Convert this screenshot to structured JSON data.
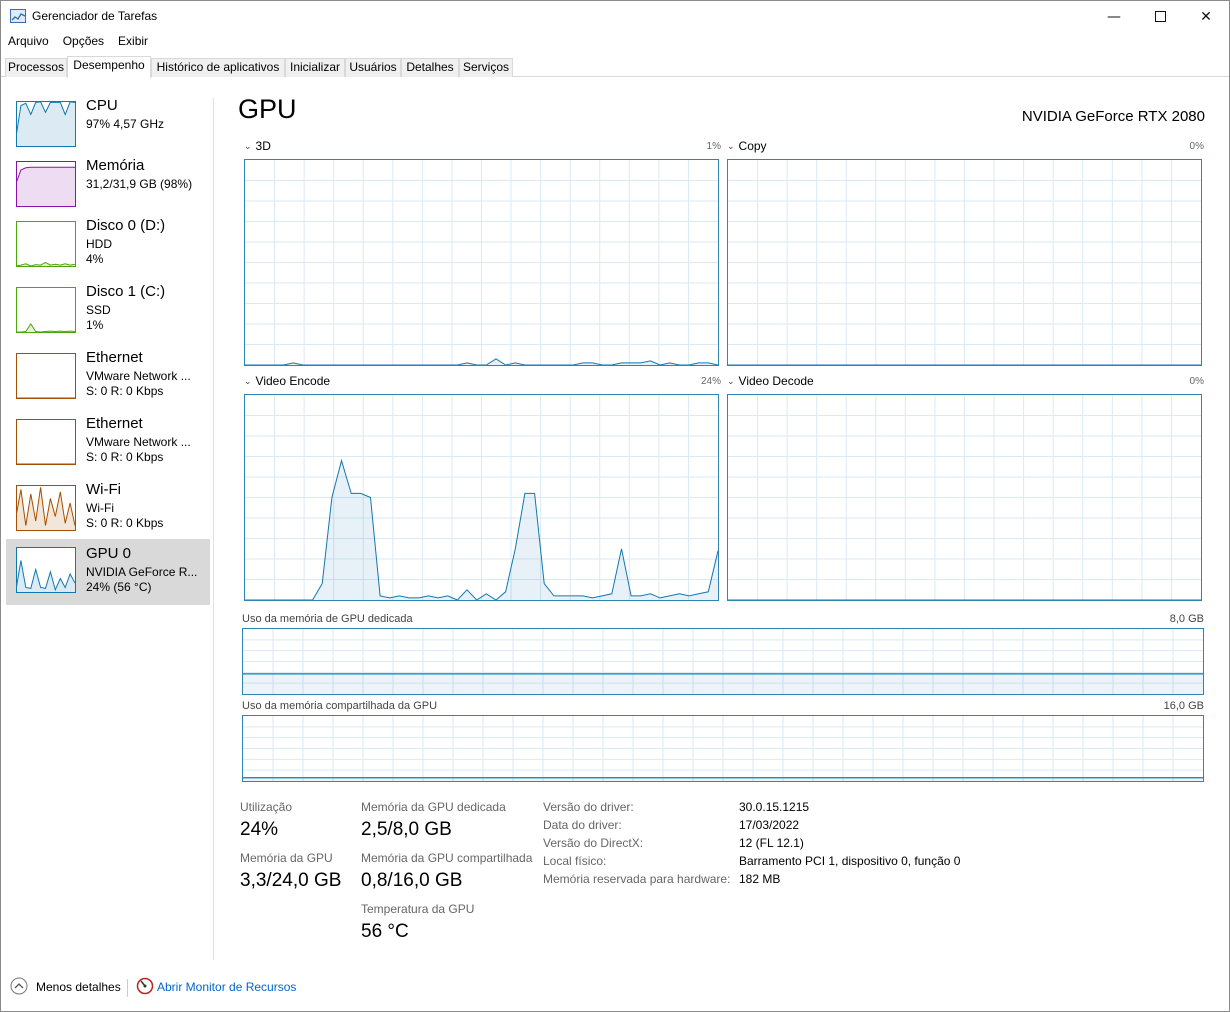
{
  "window": {
    "title": "Gerenciador de Tarefas"
  },
  "menu": [
    "Arquivo",
    "Opções",
    "Exibir"
  ],
  "tabs": [
    "Processos",
    "Desempenho",
    "Histórico de aplicativos",
    "Inicializar",
    "Usuários",
    "Detalhes",
    "Serviços"
  ],
  "active_tab": "Desempenho",
  "sidebar": {
    "items": [
      {
        "title": "CPU",
        "l1": "97% 4,57 GHz",
        "l2": "",
        "color": "#1178b0",
        "usage": 0.97
      },
      {
        "title": "Memória",
        "l1": "31,2/31,9 GB (98%)",
        "l2": "",
        "color": "#8b12ae",
        "usage": 0.98
      },
      {
        "title": "Disco 0 (D:)",
        "l1": "HDD",
        "l2": "4%",
        "color": "#4da60c",
        "usage": 0.04
      },
      {
        "title": "Disco 1 (C:)",
        "l1": "SSD",
        "l2": "1%",
        "color": "#4da60c",
        "usage": 0.01
      },
      {
        "title": "Ethernet",
        "l1": "VMware Network ...",
        "l2": "S: 0 R: 0 Kbps",
        "color": "#a74f01",
        "usage": 0
      },
      {
        "title": "Ethernet",
        "l1": "VMware Network ...",
        "l2": "S: 0 R: 0 Kbps",
        "color": "#a74f01",
        "usage": 0
      },
      {
        "title": "Wi-Fi",
        "l1": "Wi-Fi",
        "l2": "S: 0 R: 0 Kbps",
        "color": "#a74f01",
        "usage": 0
      },
      {
        "title": "GPU 0",
        "l1": "NVIDIA GeForce R...",
        "l2": "24% (56 °C)",
        "color": "#1178b0",
        "usage": 0.24
      }
    ]
  },
  "main": {
    "title": "GPU",
    "model": "NVIDIA GeForce RTX 2080",
    "engines": [
      {
        "name": "3D",
        "pct": "1%"
      },
      {
        "name": "Copy",
        "pct": "0%"
      },
      {
        "name": "Video Encode",
        "pct": "24%"
      },
      {
        "name": "Video Decode",
        "pct": "0%"
      }
    ],
    "dedicated_label": "Uso da memória de GPU dedicada",
    "dedicated_max": "8,0 GB",
    "dedicated_fraction": 0.31,
    "shared_label": "Uso da memória compartilhada da GPU",
    "shared_max": "16,0 GB",
    "shared_fraction": 0.05
  },
  "stats": {
    "util_label": "Utilização",
    "util_value": "24%",
    "gpu_mem_label": "Memória da GPU",
    "gpu_mem_value": "3,3/24,0 GB",
    "ded_label": "Memória da GPU dedicada",
    "ded_value": "2,5/8,0 GB",
    "shared_label": "Memória da GPU compartilhada",
    "shared_value": "0,8/16,0 GB",
    "temp_label": "Temperatura da GPU",
    "temp_value": "56 °C"
  },
  "info": [
    {
      "key": "Versão do driver:",
      "value": "30.0.15.1215"
    },
    {
      "key": "Data do driver:",
      "value": "17/03/2022"
    },
    {
      "key": "Versão do DirectX:",
      "value": "12 (FL 12.1)"
    },
    {
      "key": "Local físico:",
      "value": "Barramento PCI 1, dispositivo 0, função 0"
    },
    {
      "key": "Memória reservada para hardware:",
      "value": "182 MB"
    }
  ],
  "footer": {
    "less_details": "Menos detalhes",
    "resource_monitor": "Abrir Monitor de Recursos"
  },
  "graph_color": "#1178b0"
}
